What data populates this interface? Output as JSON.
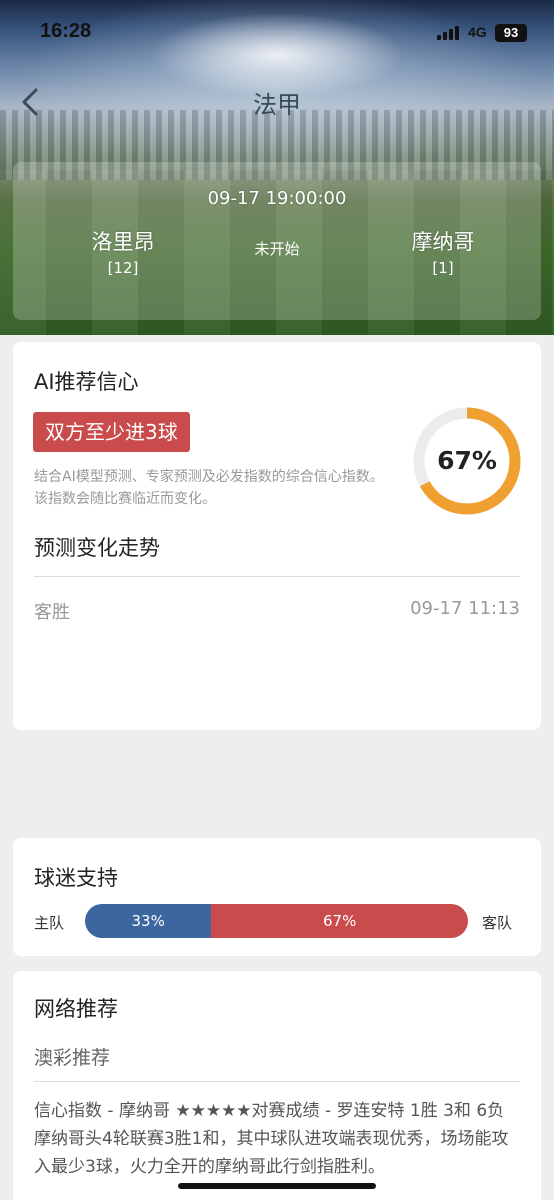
{
  "status_bar": {
    "time": "16:28",
    "network": "4G",
    "battery": "93"
  },
  "nav": {
    "title": "法甲"
  },
  "match": {
    "datetime": "09-17 19:00:00",
    "status": "未开始",
    "home": {
      "name": "洛里昂",
      "rank": "[12]"
    },
    "away": {
      "name": "摩纳哥",
      "rank": "[1]"
    }
  },
  "ai": {
    "title": "AI推荐信心",
    "pick": "双方至少进3球",
    "description": "结合AI模型预测、专家预测及必发指数的综合信心指数。该指数会随比赛临近而变化。",
    "confidence_label": "67%",
    "confidence": 0.67,
    "ring_color": "#f0a030",
    "ring_bg_color": "#ececec"
  },
  "trend": {
    "title": "预测变化走势",
    "rows": [
      {
        "pick": "客胜",
        "time": "09-17 11:13"
      }
    ]
  },
  "fans": {
    "title": "球迷支持",
    "home_label": "主队",
    "away_label": "客队",
    "home_pct": 33,
    "away_pct": 67,
    "home_text": "33%",
    "away_text": "67%",
    "home_color": "#3d65a0",
    "away_color": "#c94b4c"
  },
  "network_pick": {
    "title": "网络推荐",
    "subtitle": "澳彩推荐",
    "text": "信心指数 - 摩纳哥 ★★★★★对赛成绩 - 罗连安特 1胜 3和 6负 摩纳哥头4轮联赛3胜1和，其中球队进攻端表现优秀，场场能攻入最少3球，火力全开的摩纳哥此行剑指胜利。"
  },
  "icons": {
    "back": "chevron-left-icon",
    "signal": "signal-icon",
    "battery": "battery-icon"
  }
}
